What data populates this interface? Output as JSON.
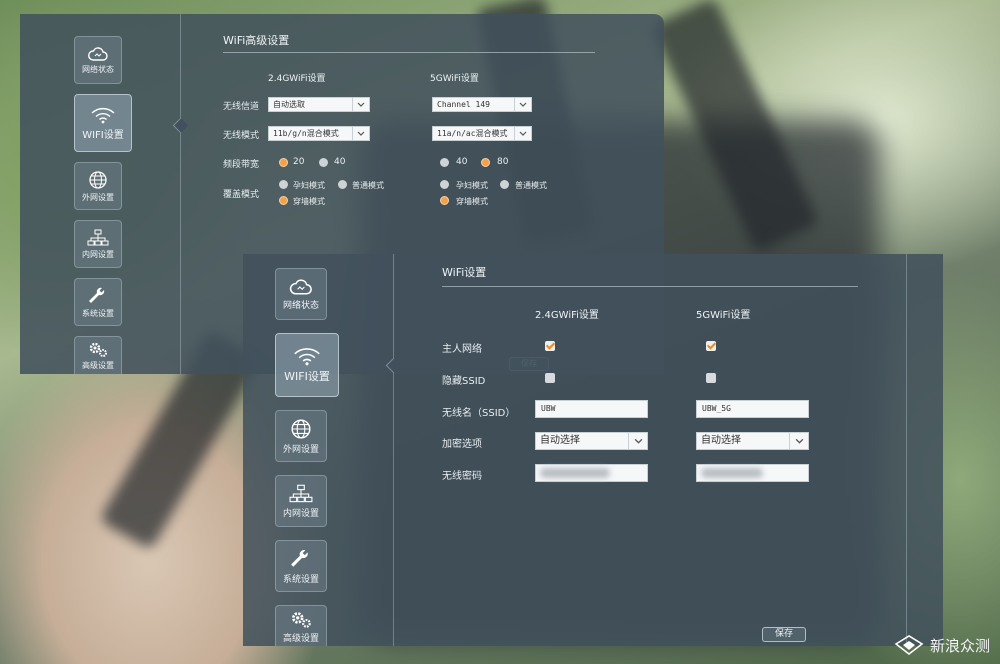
{
  "sidebar": {
    "items": [
      {
        "label": "网络状态",
        "icon": "cloud-icon"
      },
      {
        "label": "WIFI设置",
        "icon": "wifi-icon"
      },
      {
        "label": "外网设置",
        "icon": "globe-icon"
      },
      {
        "label": "内网设置",
        "icon": "network-icon"
      },
      {
        "label": "系统设置",
        "icon": "wrench-icon"
      },
      {
        "label": "高级设置",
        "icon": "gears-icon"
      }
    ]
  },
  "advanced": {
    "title": "WiFi高级设置",
    "col_24": "2.4GWiFi设置",
    "col_5": "5GWiFi设置",
    "labels": {
      "channel": "无线信道",
      "mode": "无线模式",
      "bandwidth": "频段带宽",
      "coverage": "覆盖模式"
    },
    "g24": {
      "channel": "自动选取",
      "mode": "11b/g/n混合模式",
      "bandwidth_options": [
        "20",
        "40"
      ],
      "bandwidth_selected": "20",
      "coverage_options": [
        "孕妇模式",
        "普通模式",
        "穿墙模式"
      ],
      "coverage_selected": "穿墙模式"
    },
    "g5": {
      "channel": "Channel 149",
      "mode": "11a/n/ac混合模式",
      "bandwidth_options": [
        "40",
        "80"
      ],
      "bandwidth_selected": "80",
      "coverage_options": [
        "孕妇模式",
        "普通模式",
        "穿墙模式"
      ],
      "coverage_selected": "穿墙模式"
    },
    "save_label": "保存"
  },
  "wifi": {
    "title": "WiFi设置",
    "col_24": "2.4GWiFi设置",
    "col_5": "5GWiFi设置",
    "labels": {
      "main": "主人网络",
      "hide": "隐藏SSID",
      "ssid": "无线名（SSID）",
      "encrypt": "加密选项",
      "password": "无线密码"
    },
    "g24": {
      "main": true,
      "hide": false,
      "ssid": "UBW",
      "encrypt": "自动选择"
    },
    "g5": {
      "main": true,
      "hide": false,
      "ssid": "UBW_5G",
      "encrypt": "自动选择"
    },
    "save_label": "保存"
  },
  "watermark": {
    "text": "新浪众测"
  },
  "colors": {
    "accent": "#f2a14a",
    "panel": "#41505c"
  }
}
